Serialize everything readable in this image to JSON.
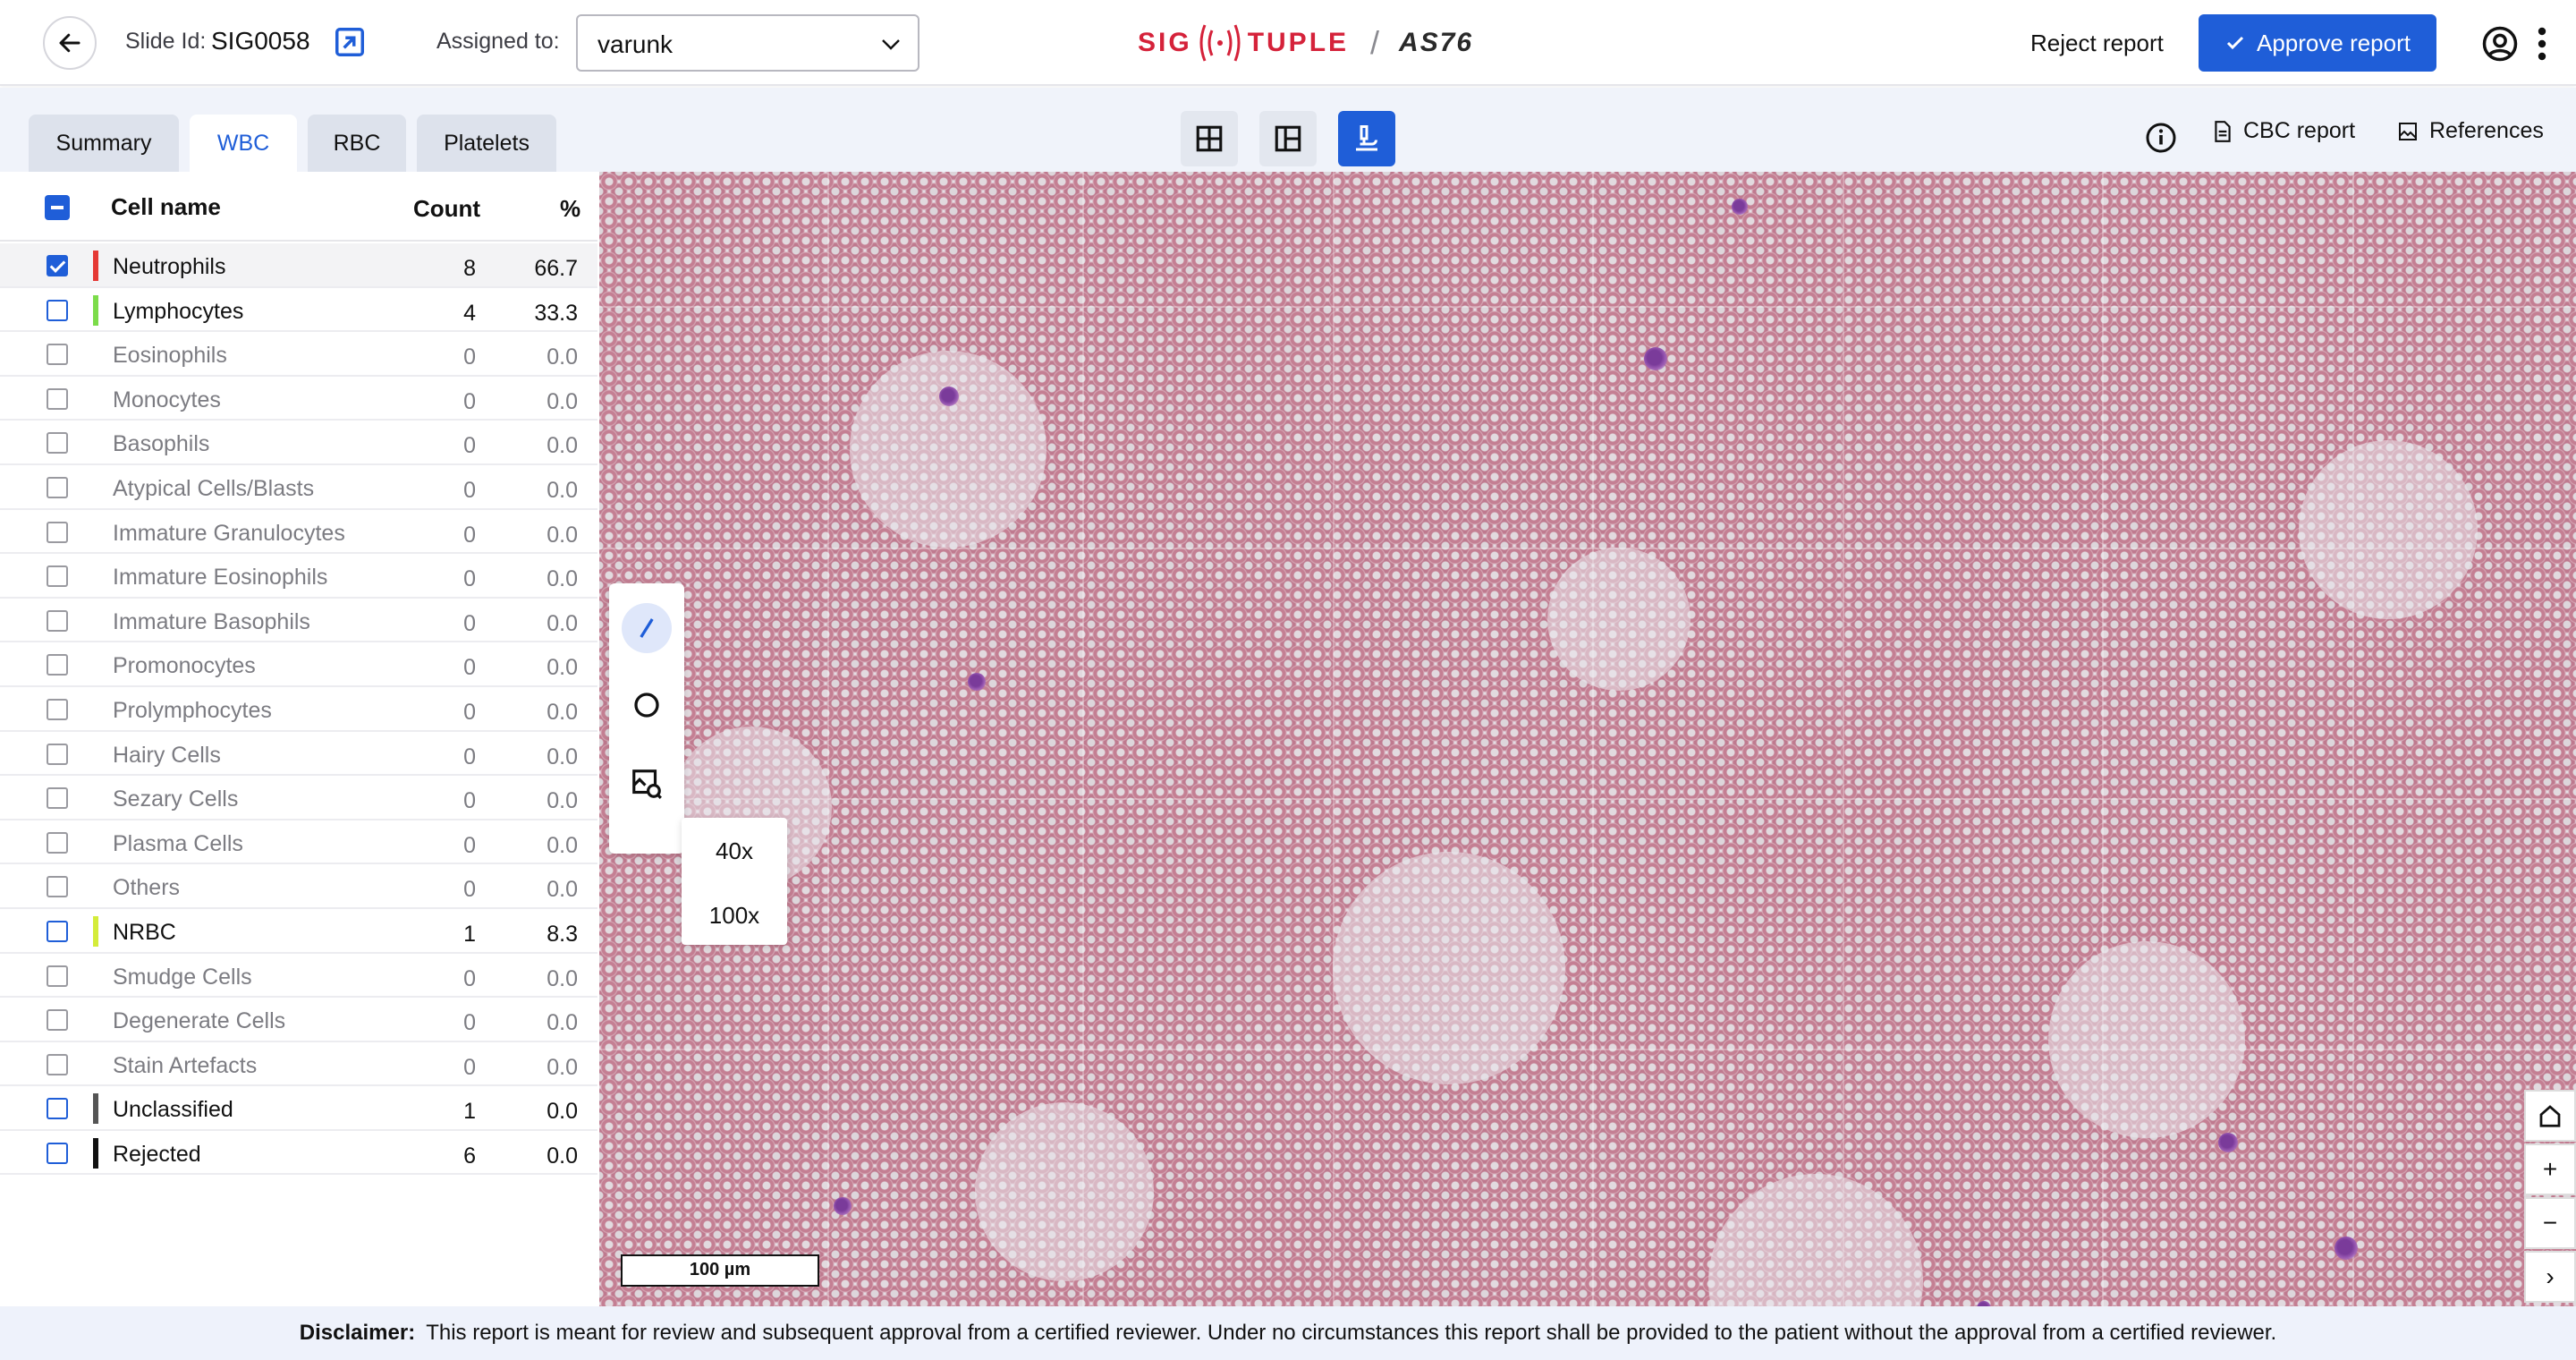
{
  "header": {
    "slide_label": "Slide Id:",
    "slide_id": "SIG0058",
    "assigned_label": "Assigned to:",
    "assigned_value": "varunk",
    "logo_left": "SIG",
    "logo_right": "TUPLE",
    "logo_model": "AS76",
    "reject_label": "Reject report",
    "approve_label": "Approve report",
    "accent_color": "#1f5ed8",
    "brand_color": "#d5223a"
  },
  "tabs": [
    {
      "label": "Summary",
      "active": false
    },
    {
      "label": "WBC",
      "active": true
    },
    {
      "label": "RBC",
      "active": false
    },
    {
      "label": "Platelets",
      "active": false
    }
  ],
  "toolbar_right": {
    "cbc_label": "CBC report",
    "references_label": "References"
  },
  "table": {
    "col_name": "Cell name",
    "col_count": "Count",
    "col_pct": "%",
    "rows": [
      {
        "name": "Neutrophils",
        "count": "8",
        "pct": "66.7",
        "color": "#e53935",
        "checked": true,
        "active": true
      },
      {
        "name": "Lymphocytes",
        "count": "4",
        "pct": "33.3",
        "color": "#7cdc4a",
        "checked": false,
        "active": true
      },
      {
        "name": "Eosinophils",
        "count": "0",
        "pct": "0.0",
        "color": "",
        "checked": false,
        "active": false
      },
      {
        "name": "Monocytes",
        "count": "0",
        "pct": "0.0",
        "color": "",
        "checked": false,
        "active": false
      },
      {
        "name": "Basophils",
        "count": "0",
        "pct": "0.0",
        "color": "",
        "checked": false,
        "active": false
      },
      {
        "name": "Atypical Cells/Blasts",
        "count": "0",
        "pct": "0.0",
        "color": "",
        "checked": false,
        "active": false
      },
      {
        "name": "Immature Granulocytes",
        "count": "0",
        "pct": "0.0",
        "color": "",
        "checked": false,
        "active": false
      },
      {
        "name": "Immature Eosinophils",
        "count": "0",
        "pct": "0.0",
        "color": "",
        "checked": false,
        "active": false
      },
      {
        "name": "Immature Basophils",
        "count": "0",
        "pct": "0.0",
        "color": "",
        "checked": false,
        "active": false
      },
      {
        "name": "Promonocytes",
        "count": "0",
        "pct": "0.0",
        "color": "",
        "checked": false,
        "active": false
      },
      {
        "name": "Prolymphocytes",
        "count": "0",
        "pct": "0.0",
        "color": "",
        "checked": false,
        "active": false
      },
      {
        "name": "Hairy Cells",
        "count": "0",
        "pct": "0.0",
        "color": "",
        "checked": false,
        "active": false
      },
      {
        "name": "Sezary Cells",
        "count": "0",
        "pct": "0.0",
        "color": "",
        "checked": false,
        "active": false
      },
      {
        "name": "Plasma Cells",
        "count": "0",
        "pct": "0.0",
        "color": "",
        "checked": false,
        "active": false
      },
      {
        "name": "Others",
        "count": "0",
        "pct": "0.0",
        "color": "",
        "checked": false,
        "active": false
      },
      {
        "name": "NRBC",
        "count": "1",
        "pct": "8.3",
        "color": "#d4ec3a",
        "checked": false,
        "active": true
      },
      {
        "name": "Smudge Cells",
        "count": "0",
        "pct": "0.0",
        "color": "",
        "checked": false,
        "active": false
      },
      {
        "name": "Degenerate Cells",
        "count": "0",
        "pct": "0.0",
        "color": "",
        "checked": false,
        "active": false
      },
      {
        "name": "Stain Artefacts",
        "count": "0",
        "pct": "0.0",
        "color": "",
        "checked": false,
        "active": false
      },
      {
        "name": "Unclassified",
        "count": "1",
        "pct": "0.0",
        "color": "#555555",
        "checked": false,
        "active": true
      },
      {
        "name": "Rejected",
        "count": "6",
        "pct": "0.0",
        "color": "#111111",
        "checked": false,
        "active": true
      }
    ]
  },
  "viewer": {
    "zoom_options": [
      "40x",
      "100x"
    ],
    "scale_label": "100 µm",
    "nav": {
      "home": "home-icon",
      "zoom_in": "+",
      "zoom_out": "−",
      "expand": "›"
    }
  },
  "footer": {
    "disclaimer_label": "Disclaimer:",
    "disclaimer_text": "This report is meant for review and subsequent approval from a certified reviewer. Under no circumstances this report shall be provided to the patient without the approval from a certified reviewer."
  }
}
